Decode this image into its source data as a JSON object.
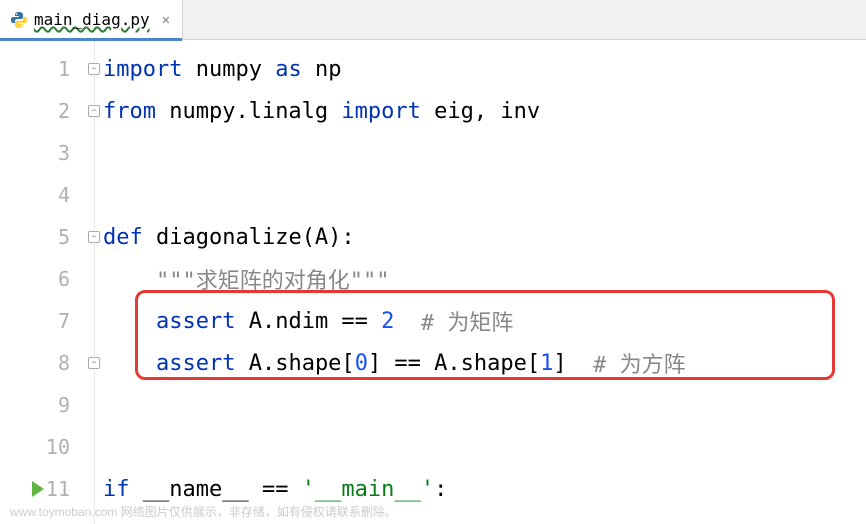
{
  "tab": {
    "filename": "main_diag.py",
    "close_glyph": "✕"
  },
  "gutter": {
    "lines": [
      "1",
      "2",
      "3",
      "4",
      "5",
      "6",
      "7",
      "8",
      "9",
      "10",
      "11"
    ]
  },
  "code": {
    "l1": {
      "kw1": "import",
      "t1": " numpy ",
      "kw2": "as",
      "t2": " np"
    },
    "l2": {
      "kw1": "from",
      "t1": " numpy.linalg ",
      "kw2": "import",
      "t2": " eig, inv"
    },
    "l5": {
      "kw1": "def",
      "t1": " diagonalize(A):"
    },
    "l6": {
      "doc": "    \"\"\"求矩阵的对角化\"\"\""
    },
    "l7": {
      "kw1": "assert",
      "t1": " A.ndim == ",
      "num1": "2",
      "c1": "  # 为矩阵"
    },
    "l8": {
      "kw1": "assert",
      "t1": " A.shape[",
      "num1": "0",
      "t2": "] == A.shape[",
      "num2": "1",
      "t3": "]  ",
      "c1": "# 为方阵"
    },
    "l11": {
      "kw1": "if",
      "t1": " __name__ == ",
      "str1": "'__main__'",
      "t2": ":"
    }
  },
  "watermark": "www.toymoban.com    网络图片仅供展示，非存储，如有侵权请联系删除。"
}
